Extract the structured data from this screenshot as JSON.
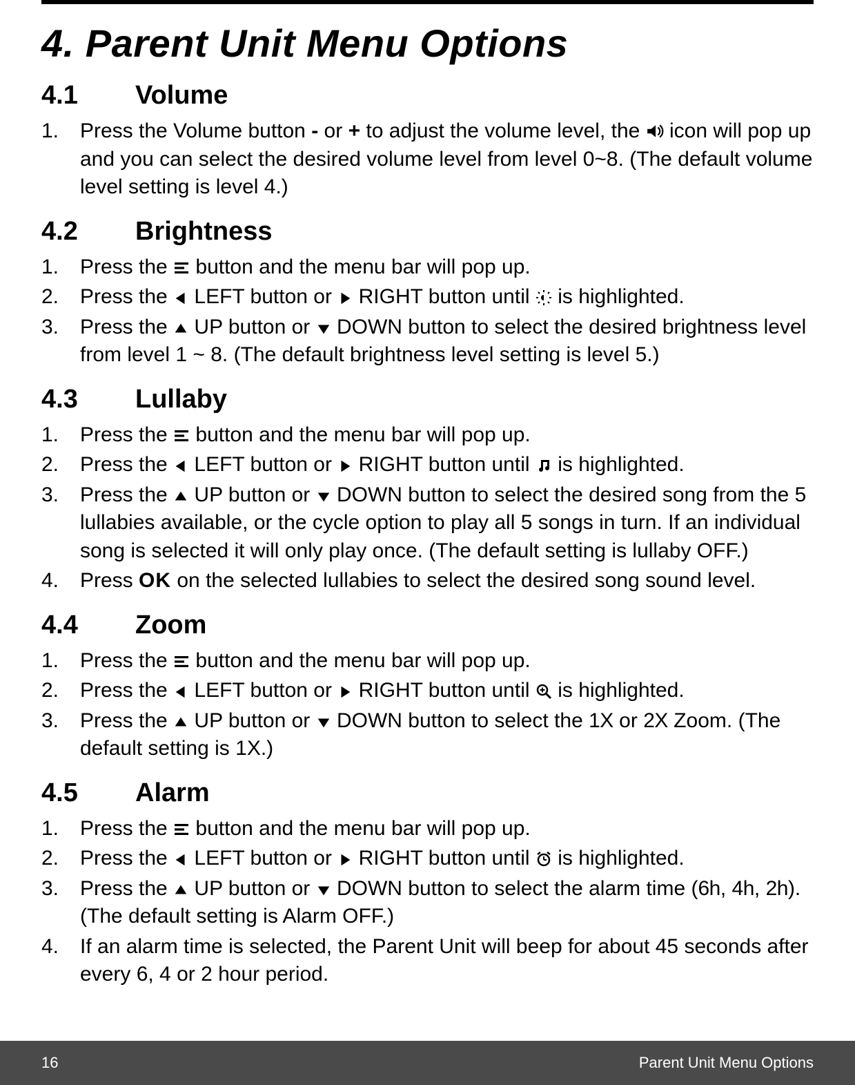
{
  "title": "4. Parent Unit Menu Options",
  "sections": {
    "volume": {
      "num": "4.1",
      "name": "Volume",
      "steps": {
        "s1_a": "Press the Volume button ",
        "s1_minus": "-",
        "s1_b": " or ",
        "s1_plus": "+",
        "s1_c": " to adjust the volume level, the ",
        "s1_d": " icon will pop up and you can select the desired volume level from level 0~8. (The default volume level setting is level 4.)"
      }
    },
    "brightness": {
      "num": "4.2",
      "name": "Brightness",
      "steps": {
        "s1_a": "Press the ",
        "s1_b": " button and the menu bar will pop up.",
        "s2_a": "Press the ",
        "s2_left": " LEFT button or ",
        "s2_right": " RIGHT button until ",
        "s2_end": " is highlighted.",
        "s3_a": "Press the ",
        "s3_up": " UP button or ",
        "s3_down": " DOWN button to select the desired brightness level from level 1 ~ 8. (The default brightness level setting is level 5.)"
      }
    },
    "lullaby": {
      "num": "4.3",
      "name": "Lullaby",
      "steps": {
        "s1_a": "Press the ",
        "s1_b": " button and the menu bar will pop up.",
        "s2_a": "Press the ",
        "s2_left": " LEFT button or ",
        "s2_right": " RIGHT button until ",
        "s2_end": " is highlighted.",
        "s3_a": "Press the ",
        "s3_up": " UP button or ",
        "s3_down": " DOWN button to select the desired song from the 5 lullabies available, or the cycle option to play all 5 songs in turn. If an individual song is selected it will only play once. (The default setting is lullaby OFF.)",
        "s4_a": "Press ",
        "s4_ok": "OK",
        "s4_b": " on the selected lullabies to select the desired song sound level."
      }
    },
    "zoom": {
      "num": "4.4",
      "name": "Zoom",
      "steps": {
        "s1_a": "Press the ",
        "s1_b": " button and the menu bar will pop up.",
        "s2_a": "Press the ",
        "s2_left": " LEFT button or ",
        "s2_right": " RIGHT button until ",
        "s2_end": " is highlighted.",
        "s3_a": "Press the ",
        "s3_up": " UP button or ",
        "s3_down": " DOWN button to select the ",
        "s3_1x": "1X",
        "s3_mid": " or ",
        "s3_2x": "2X",
        "s3_end": " Zoom. (The default setting is 1X.)"
      }
    },
    "alarm": {
      "num": "4.5",
      "name": "Alarm",
      "steps": {
        "s1_a": "Press the ",
        "s1_b": " button and the menu bar will pop up.",
        "s2_a": "Press the ",
        "s2_left": " LEFT button or ",
        "s2_right": " RIGHT button until ",
        "s2_end": " is highlighted.",
        "s3_a": "Press the ",
        "s3_up": " UP button or ",
        "s3_down": "  DOWN button to select the alarm time (",
        "s3_6h": "6h",
        "s3_c1": ", ",
        "s3_4h": "4h",
        "s3_c2": ", ",
        "s3_2h": "2h",
        "s3_end": "). (The default setting is Alarm OFF.)",
        "s4": "If an alarm time is selected, the Parent Unit will beep for about 45 seconds after every 6, 4 or 2 hour period."
      }
    }
  },
  "footer": {
    "page": "16",
    "label": "Parent Unit Menu Options"
  },
  "nums": {
    "n1": "1.",
    "n2": "2.",
    "n3": "3.",
    "n4": "4."
  }
}
